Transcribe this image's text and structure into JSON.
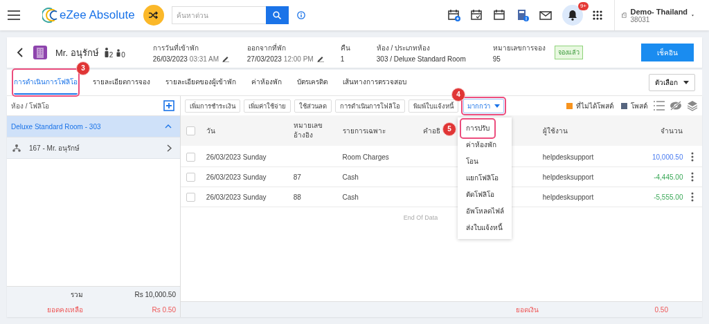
{
  "topbar": {
    "logo": "eZee Absolute",
    "search": {
      "placeholder": "ค้นหาด่วน"
    },
    "notification_badge": "9+",
    "property": {
      "name": "Demo- Thailand",
      "code": "38031"
    }
  },
  "guest": {
    "name": "Mr. อนุรักษ์",
    "adults": "2",
    "children": "0",
    "fields": [
      {
        "label": "การวันที่เข้าพัก",
        "value": "26/03/2023",
        "time": "03:31 AM",
        "editable": true
      },
      {
        "label": "ออกจากที่พัก",
        "value": "27/03/2023",
        "time": "12:00 PM",
        "editable": true
      },
      {
        "label": "คืน",
        "value": "1",
        "editable": false
      },
      {
        "label": "ห้อง / ประเภทห้อง",
        "value": "303 / Deluxe Standard Room",
        "editable": false
      },
      {
        "label": "หมายเลขการจอง",
        "value": "95",
        "editable": false
      }
    ],
    "status": "จองแล้ว",
    "action_button": "เช็คอิน"
  },
  "tabs": [
    {
      "label": "การดำเนินการโฟลิโอ",
      "selected": true,
      "callout": "3"
    },
    {
      "label": "รายละเอียดการจอง",
      "selected": false
    },
    {
      "label": "รายละเอียดของผู้เข้าพัก",
      "selected": false
    },
    {
      "label": "ค่าห้องพัก",
      "selected": false
    },
    {
      "label": "บัตรเครดิต",
      "selected": false
    },
    {
      "label": "เส้นทางการตรวจสอบ",
      "selected": false
    }
  ],
  "options_button": "ตัวเลือก",
  "folio_panel": {
    "title": "ห้อง / โฟลิโอ",
    "rooms": [
      {
        "label": "Deluxe Standard Room - 303",
        "expanded": true,
        "children": [
          {
            "label": "167 - Mr. อนุรักษ์"
          }
        ]
      }
    ],
    "total_label": "รวม",
    "total": "Rs 10,000.50",
    "balance_label": "ยอดคงเหลือ",
    "balance": "Rs 0.50"
  },
  "toolbar": {
    "buttons": [
      "เพิ่มการชำระเงิน",
      "เพิ่มค่าใช้จ่าย",
      "ใช้ส่วนลด",
      "การดำเนินการโฟลิโอ",
      "พิมพ์ใบแจ้งหนี้"
    ],
    "more": {
      "label": "มากกว่า",
      "expanded": true,
      "callout": "4",
      "items": [
        {
          "label": "การปรับ",
          "callout": "5"
        },
        {
          "label": "ค่าห้องพัก"
        },
        {
          "label": "โอน"
        },
        {
          "label": "แยกโฟลิโอ"
        },
        {
          "label": "ตัดโฟลิโอ"
        },
        {
          "label": "อัพโหลดไฟล์"
        },
        {
          "label": "ส่งใบแจ้งหนี้"
        }
      ]
    },
    "legend": [
      {
        "label": "ที่ไม่ได้โพสต์",
        "color": "#f7931e"
      },
      {
        "label": "โพสต์",
        "color": "#56657f"
      }
    ]
  },
  "table": {
    "all_checked": false,
    "columns": [
      "วัน",
      "หมายเลข อ้างอิง",
      "รายการเฉพาะ",
      "คำอธิ",
      "ผู้ใช้งาน",
      "จำนวน"
    ],
    "rows": [
      {
        "date": "26/03/2023 Sunday",
        "ref": "",
        "item": "Room Charges",
        "user": "helpdesksupport",
        "amount": "10,000.50",
        "kind": "charge",
        "checked": false
      },
      {
        "date": "26/03/2023 Sunday",
        "ref": "87",
        "item": "Cash",
        "user": "helpdesksupport",
        "amount": "-4,445.00",
        "kind": "payment",
        "checked": false
      },
      {
        "date": "26/03/2023 Sunday",
        "ref": "88",
        "item": "Cash",
        "user": "helpdesksupport",
        "amount": "-5,555.00",
        "kind": "payment",
        "checked": false
      }
    ],
    "end_text": "End Of Data",
    "footer_label": "ยอดเงิน",
    "footer_value": "0.50"
  }
}
